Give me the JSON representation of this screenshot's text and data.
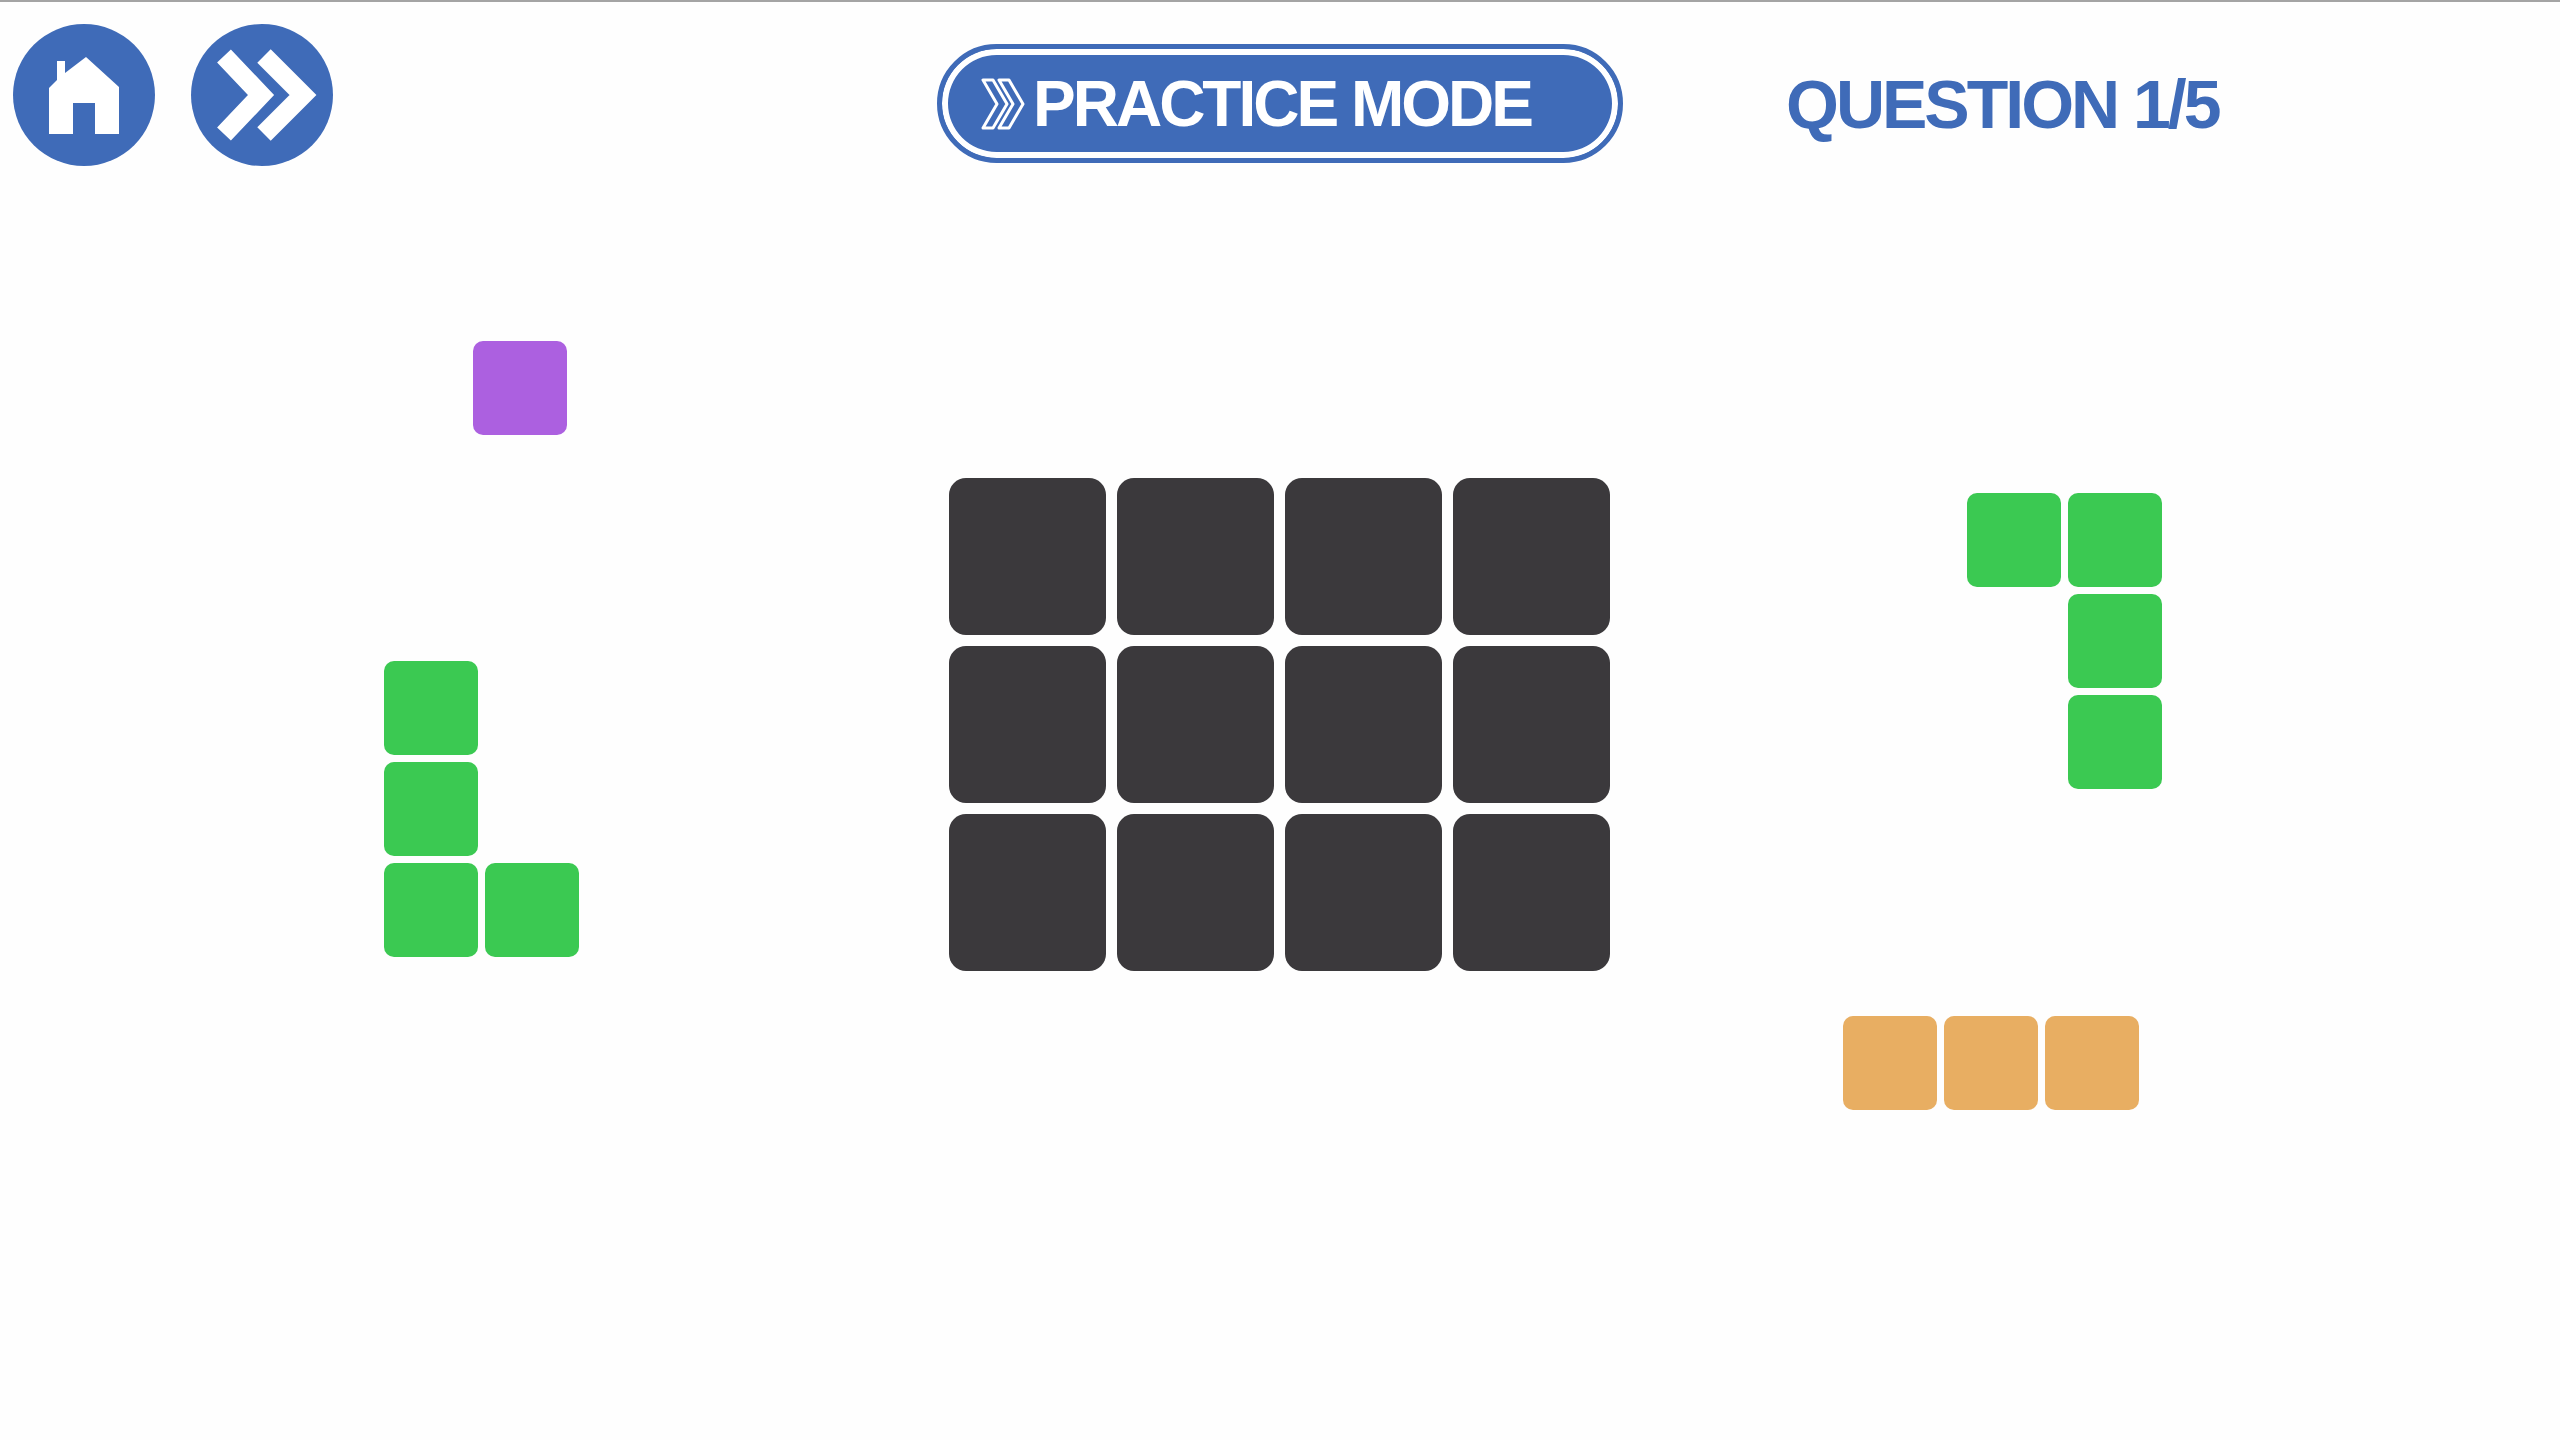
{
  "toolbar": {
    "mode_banner": {
      "label": "PRACTICE MODE"
    },
    "question_counter": "QUESTION 1/5"
  },
  "board": {
    "rows": [
      {
        "slots": [
          {
            "filled": false
          },
          {
            "filled": false
          },
          {
            "filled": false
          },
          {
            "filled": false
          }
        ]
      },
      {
        "slots": [
          {
            "filled": false
          },
          {
            "filled": false
          },
          {
            "filled": false
          },
          {
            "filled": false
          }
        ]
      },
      {
        "slots": [
          {
            "filled": false
          },
          {
            "filled": false
          },
          {
            "filled": false
          },
          {
            "filled": false
          }
        ]
      }
    ]
  },
  "pieces": [
    {
      "kind": "square",
      "color": "#ac60e0"
    },
    {
      "kind": "ell",
      "color": "#3bc952"
    },
    {
      "kind": "hook",
      "color": "#3bc952"
    },
    {
      "kind": "bar",
      "color": "#e8ae62"
    }
  ]
}
